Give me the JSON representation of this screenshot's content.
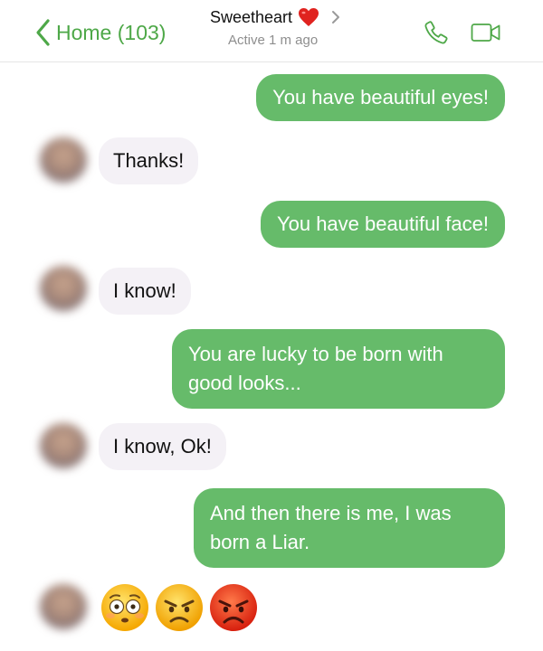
{
  "header": {
    "back_label": "Home (103)",
    "contact_name": "Sweetheart",
    "status": "Active 1 m ago"
  },
  "colors": {
    "accent": "#4ea848",
    "outgoing_bubble": "#66bb6a",
    "incoming_bubble": "#f4f1f6"
  },
  "icons": [
    "chevron-left-icon",
    "heart-icon",
    "chevron-right-icon",
    "phone-icon",
    "video-camera-icon"
  ],
  "messages": [
    {
      "direction": "out",
      "text": "You have beautiful eyes!"
    },
    {
      "direction": "in",
      "text": "Thanks!"
    },
    {
      "direction": "out",
      "text": "You have beautiful face!"
    },
    {
      "direction": "in",
      "text": "I know!"
    },
    {
      "direction": "out",
      "lines": [
        "You are lucky to be born with",
        "good looks..."
      ]
    },
    {
      "direction": "in",
      "text": "I know, Ok!"
    },
    {
      "direction": "out",
      "lines": [
        "And then there is me, I was",
        "born a Liar."
      ]
    },
    {
      "direction": "in",
      "emojis": [
        "😳",
        "😠",
        "😡"
      ]
    }
  ]
}
